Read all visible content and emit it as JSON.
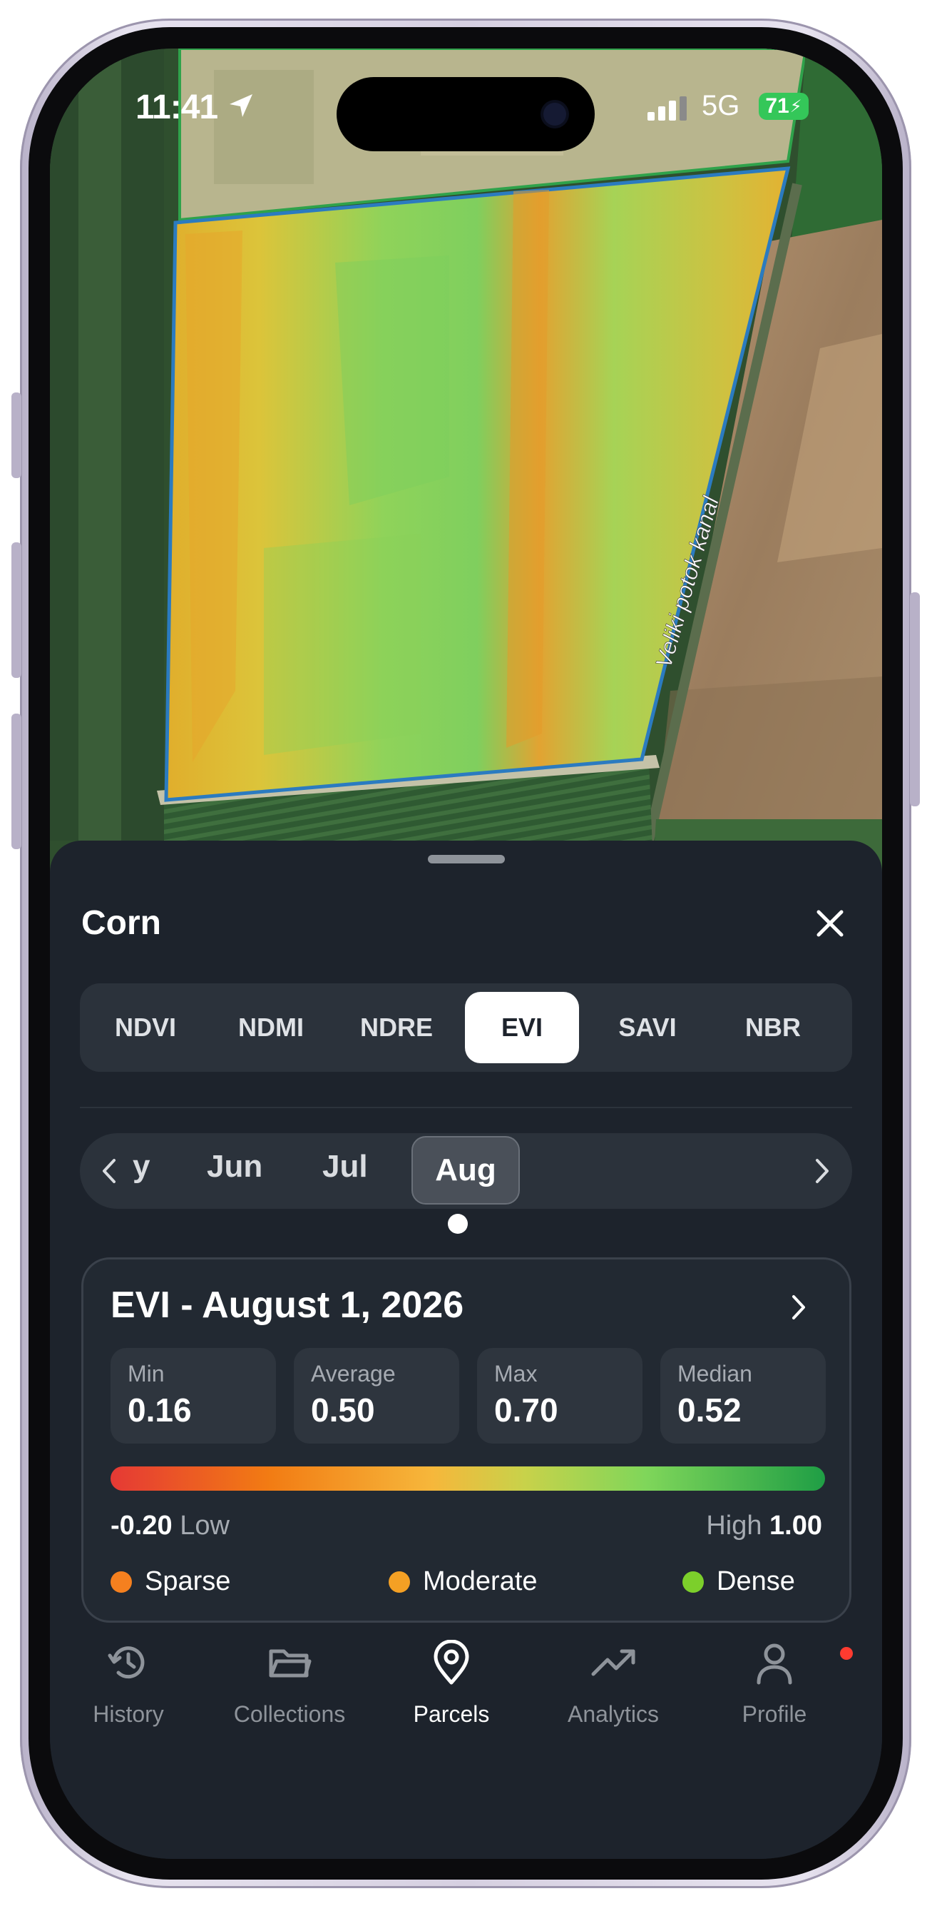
{
  "status_bar": {
    "time": "11:41",
    "network": "5G",
    "battery": "71"
  },
  "map": {
    "canal_label": "Veliki potok kanal"
  },
  "sheet": {
    "title": "Corn",
    "index_tabs": [
      {
        "label": "NDVI",
        "active": false
      },
      {
        "label": "NDMI",
        "active": false
      },
      {
        "label": "NDRE",
        "active": false
      },
      {
        "label": "EVI",
        "active": true
      },
      {
        "label": "SAVI",
        "active": false
      },
      {
        "label": "NBR",
        "active": false
      }
    ],
    "months": {
      "partial": "y",
      "items": [
        "Jun",
        "Jul"
      ],
      "active": "Aug"
    }
  },
  "stats": {
    "title": "EVI - August 1, 2026",
    "boxes": [
      {
        "label": "Min",
        "value": "0.16"
      },
      {
        "label": "Average",
        "value": "0.50"
      },
      {
        "label": "Max",
        "value": "0.70"
      },
      {
        "label": "Median",
        "value": "0.52"
      }
    ],
    "scale": {
      "low_value": "-0.20",
      "low_label": "Low",
      "high_label": "High",
      "high_value": "1.00"
    },
    "legend": [
      {
        "label": "Sparse",
        "color": "#f5801f"
      },
      {
        "label": "Moderate",
        "color": "#f4a024"
      },
      {
        "label": "Dense",
        "color": "#7ccf2b"
      }
    ]
  },
  "tabbar": {
    "items": [
      {
        "label": "History",
        "icon": "history-icon",
        "active": false
      },
      {
        "label": "Collections",
        "icon": "folder-icon",
        "active": false
      },
      {
        "label": "Parcels",
        "icon": "map-pin-icon",
        "active": true
      },
      {
        "label": "Analytics",
        "icon": "trending-up-icon",
        "active": false
      },
      {
        "label": "Profile",
        "icon": "user-icon",
        "active": false
      }
    ],
    "profile_notification": true
  },
  "colors": {
    "sheet_bg": "#1d232c",
    "accent_active_tab": "#ffffff",
    "notification": "#ff3b30",
    "field_outline": "#2b7bc0"
  }
}
